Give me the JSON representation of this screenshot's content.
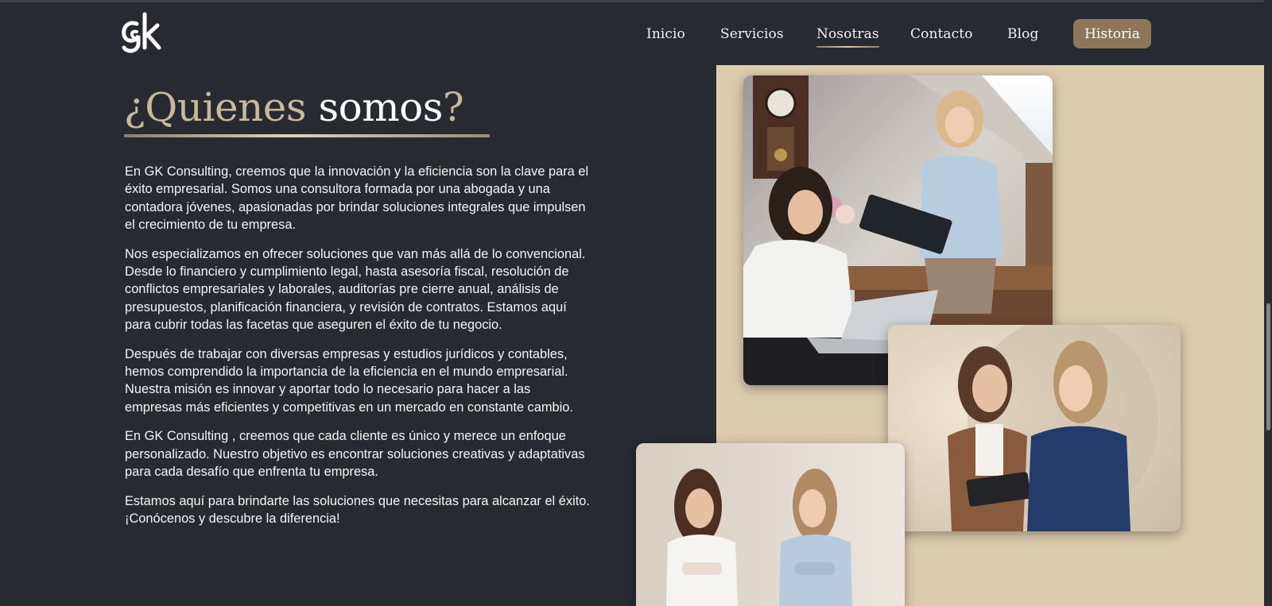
{
  "header": {
    "logo_text": "gk",
    "nav": [
      {
        "label": "Inicio"
      },
      {
        "label": "Servicios"
      },
      {
        "label": "Nosotras",
        "active": true
      },
      {
        "label": "Contacto"
      },
      {
        "label": "Blog"
      }
    ],
    "cta_label": "Historia"
  },
  "hero": {
    "title_part1": "¿Quienes",
    "title_part2": "somos",
    "title_part3": "?"
  },
  "paragraphs": [
    "En GK Consulting, creemos que la innovación y la eficiencia son la clave para el éxito empresarial. Somos una consultora formada por una abogada y una contadora jóvenes, apasionadas por brindar soluciones integrales que impulsen el crecimiento de tu empresa.",
    "Nos especializamos en ofrecer soluciones que van más allá de lo convencional. Desde lo financiero y cumplimiento legal, hasta asesoría fiscal, resolución de conflictos empresariales y laborales, auditorías pre cierre anual, análisis de presupuestos, planificación financiera, y revisión de contratos. Estamos aquí para cubrir todas las facetas que aseguren el éxito de tu negocio.",
    "Después de trabajar con diversas empresas y estudios jurídicos y contables, hemos comprendido la importancia de la eficiencia en el mundo empresarial. Nuestra misión es innovar y aportar todo lo necesario para hacer a las empresas más eficientes y competitivas en un mercado en constante cambio.",
    "En GK Consulting , creemos que cada cliente es único y merece un enfoque personalizado. Nuestro objetivo es encontrar soluciones creativas y adaptativas para cada desafío que enfrenta tu empresa.",
    "Estamos aquí para brindarte las soluciones que necesitas para alcanzar el éxito. ¡Conócenos y descubre la diferencia!"
  ],
  "colors": {
    "background": "#282a31",
    "accent_gold": "#c9b99c",
    "button": "#8d7659",
    "panel_beige": "#dccbad"
  }
}
